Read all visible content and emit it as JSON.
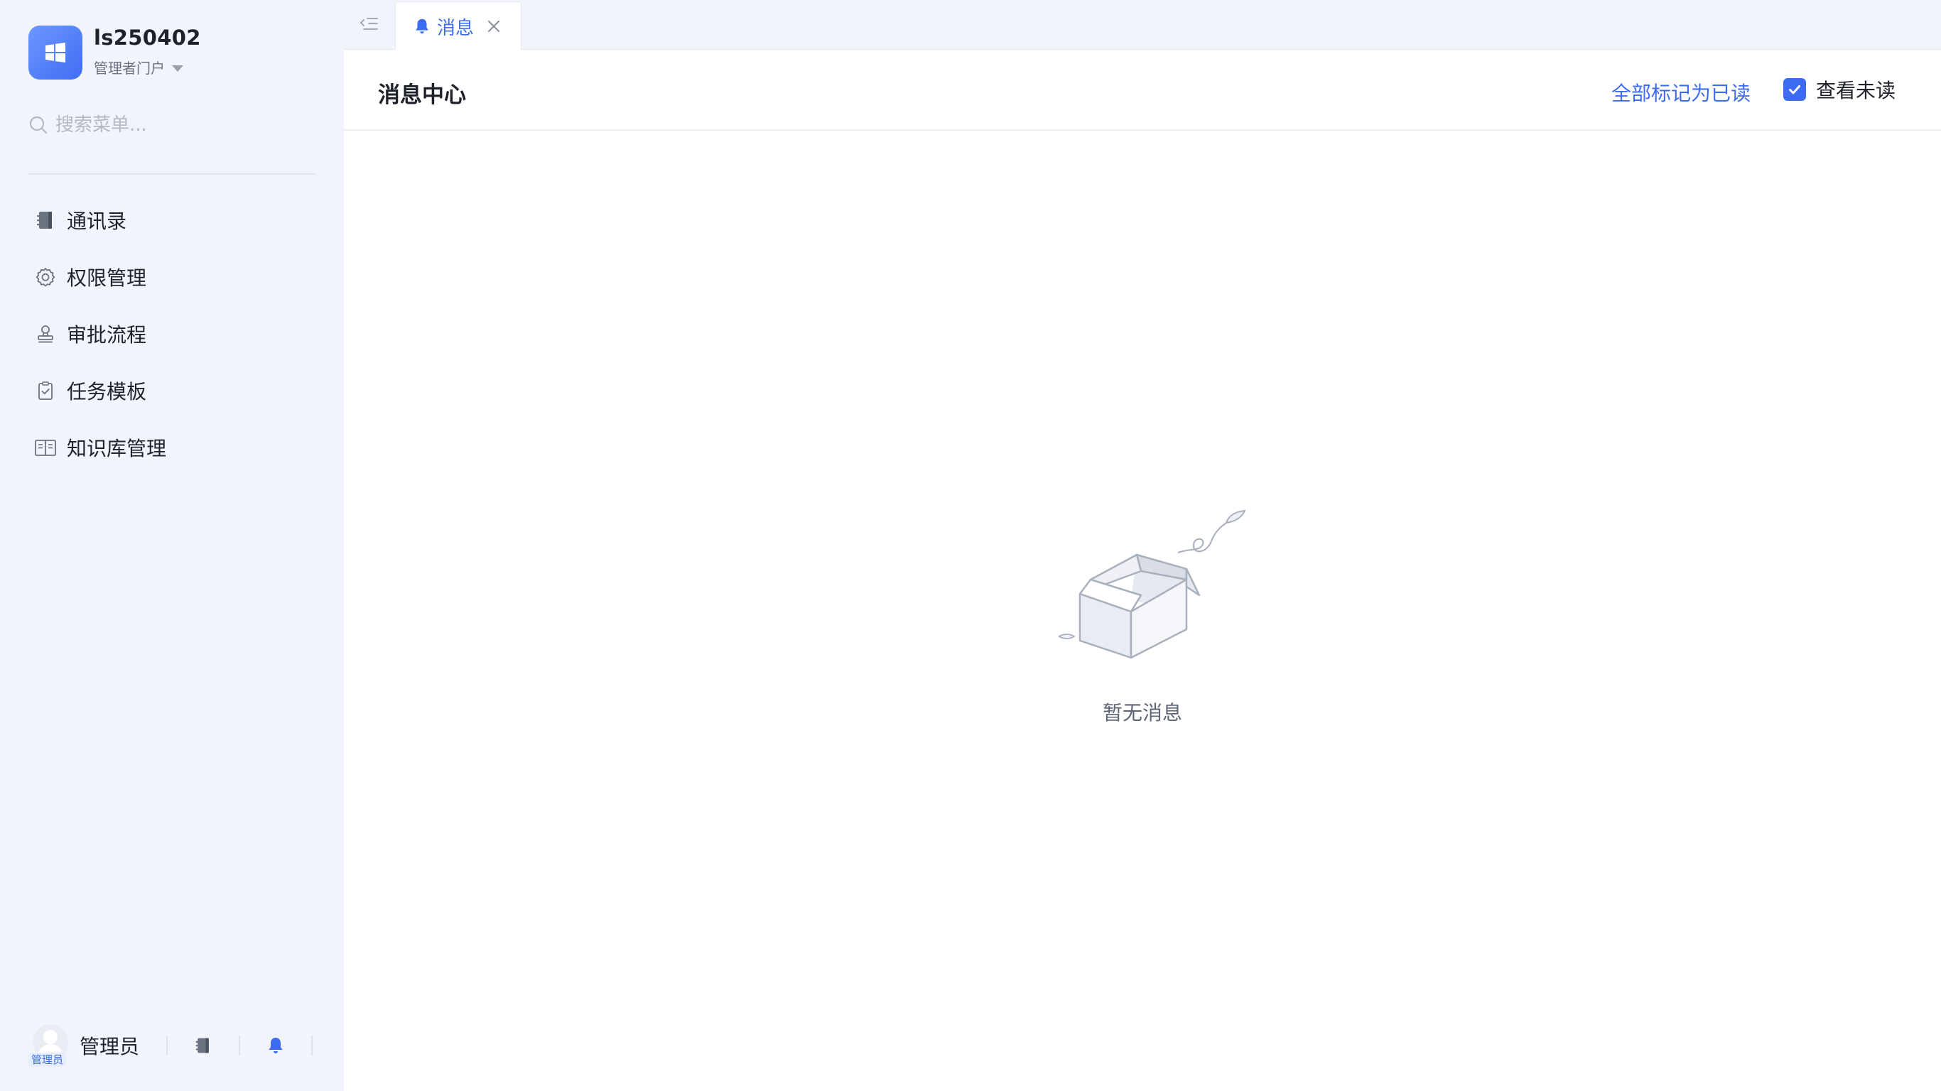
{
  "app": {
    "name": "ls250402",
    "portal": "管理者门户"
  },
  "search": {
    "placeholder": "搜索菜单..."
  },
  "sidebar": {
    "items": [
      {
        "label": "通讯录",
        "icon": "contacts-book-icon"
      },
      {
        "label": "权限管理",
        "icon": "gear-icon"
      },
      {
        "label": "审批流程",
        "icon": "stamp-icon"
      },
      {
        "label": "任务模板",
        "icon": "clipboard-check-icon"
      },
      {
        "label": "知识库管理",
        "icon": "open-book-icon"
      }
    ]
  },
  "user": {
    "name": "管理员",
    "badge": "管理员"
  },
  "tabs": [
    {
      "label": "消息",
      "icon": "bell-icon",
      "active": true
    }
  ],
  "header": {
    "title": "消息中心",
    "mark_all_read": "全部标记为已读",
    "view_unread": "查看未读",
    "view_unread_checked": true
  },
  "empty_state": {
    "text": "暂无消息",
    "icon": "empty-box-illustration"
  },
  "colors": {
    "accent": "#3d6cf0",
    "sidebar_bg": "#f2f4fb"
  }
}
